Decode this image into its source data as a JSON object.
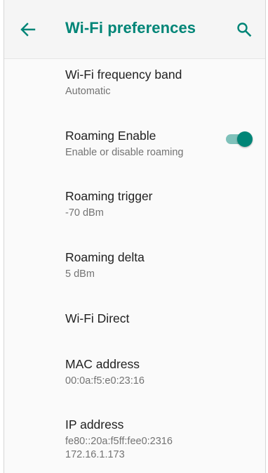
{
  "colors": {
    "accent": "#008577",
    "title_text": "#212121",
    "summary_text": "#737373",
    "switch_track": "#7fc1ba"
  },
  "appbar": {
    "back_icon": "arrow-left-icon",
    "title": "Wi-Fi preferences",
    "search_icon": "search-icon"
  },
  "preferences": [
    {
      "title": "Wi-Fi frequency band",
      "summary": "Automatic"
    },
    {
      "title": "Roaming Enable",
      "summary": "Enable or disable roaming",
      "switch_on": true
    },
    {
      "title": "Roaming trigger",
      "summary": "-70 dBm"
    },
    {
      "title": "Roaming delta",
      "summary": "5 dBm"
    },
    {
      "title": "Wi-Fi Direct"
    },
    {
      "title": "MAC address",
      "summary": "00:0a:f5:e0:23:16"
    },
    {
      "title": "IP address",
      "summary_lines": [
        "fe80::20a:f5ff:fee0:2316",
        "172.16.1.173"
      ]
    }
  ]
}
